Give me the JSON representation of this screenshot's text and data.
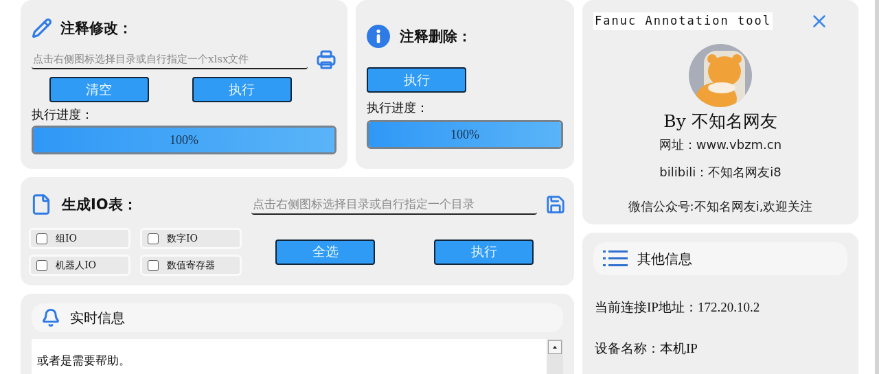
{
  "annotation_edit": {
    "title": "注释修改：",
    "path_field": {
      "placeholder": "点击右侧图标选择目录或自行指定一个xlsx文件"
    },
    "buttons": [
      "清空",
      "执行"
    ],
    "progress_label": "执行进度：",
    "progress": {
      "level": 1,
      "reading": "100%"
    }
  },
  "annotation_delete": {
    "title": "注释删除：",
    "buttons": [
      "执行"
    ],
    "progress_label": "执行进度：",
    "progress": {
      "level": 1,
      "reading": "100%"
    }
  },
  "io_table": {
    "title": "生成IO表：",
    "path_field": {
      "placeholder": "点击右侧图标选择目录或自行指定一个目录"
    },
    "options": [
      {
        "label": "组IO",
        "checked": false
      },
      {
        "label": "数字IO",
        "checked": false
      },
      {
        "label": "机器人IO",
        "checked": false
      },
      {
        "label": "数值寄存器",
        "checked": false
      }
    ],
    "buttons": [
      "全选",
      "执行"
    ]
  },
  "realtime_info": {
    "title": "实时信息",
    "log_lines": [
      "或者是需要帮助。"
    ]
  },
  "about": {
    "title": "Fanuc Annotation tool",
    "author": "By 不知名网友",
    "website": "网址：www.vbzm.cn",
    "bilibili": "bilibili：不知名网友i8",
    "wechat": "微信公众号:不知名网友i,欢迎关注"
  },
  "other_info": {
    "title": "其他信息",
    "lines": [
      "当前连接IP地址：172.20.10.2",
      "设备名称：本机IP"
    ]
  }
}
